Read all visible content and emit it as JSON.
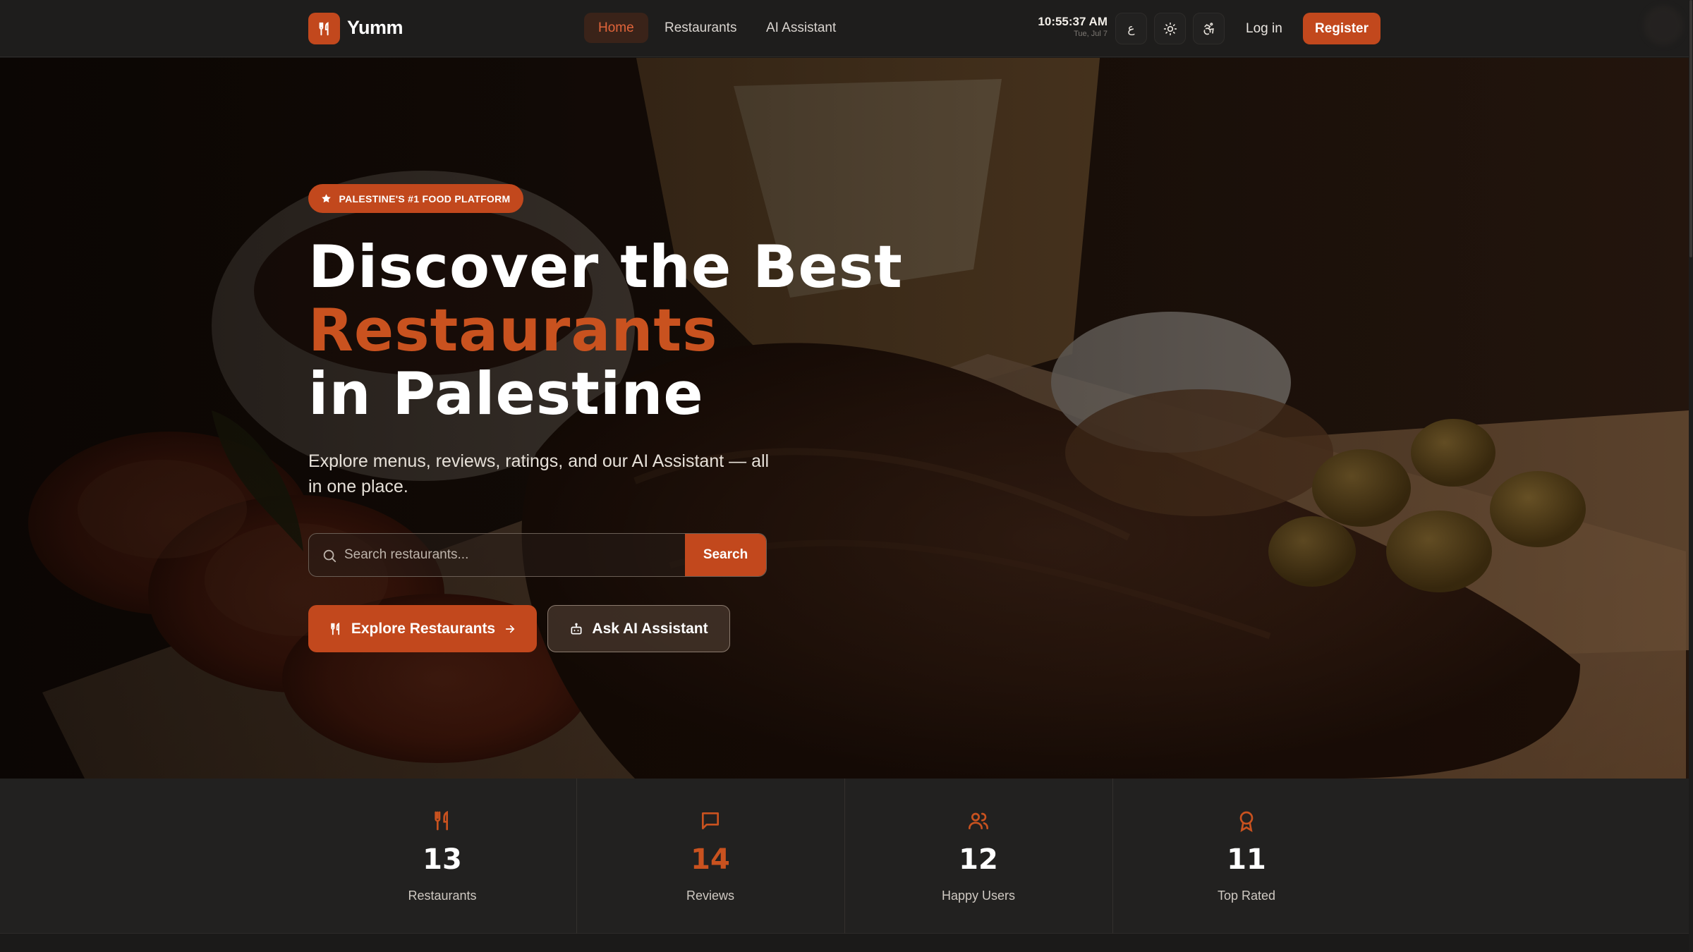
{
  "brand": {
    "name": "Yumm",
    "accent": "#c2481d"
  },
  "nav": {
    "links": [
      "Home",
      "Restaurants",
      "AI Assistant"
    ],
    "active": "Home",
    "clock_time": "10:55:37 AM",
    "clock_date": "Tue, Jul 7",
    "lang_label": "ع",
    "login": "Log in",
    "register": "Register"
  },
  "hero": {
    "badge": "PALESTINE'S #1 FOOD PLATFORM",
    "title_line1": "Discover the Best",
    "title_line2": "Restaurants",
    "title_line3": "in Palestine",
    "subtitle": "Explore menus, reviews, ratings, and our AI Assistant — all in one place.",
    "search_placeholder": "Search restaurants...",
    "search_button": "Search",
    "primary_cta": "Explore Restaurants",
    "secondary_cta": "Ask AI Assistant"
  },
  "stats": [
    {
      "icon": "utensils-icon",
      "value": "13",
      "label": "Restaurants",
      "highlight": false
    },
    {
      "icon": "message-square-icon",
      "value": "14",
      "label": "Reviews",
      "highlight": true
    },
    {
      "icon": "users-icon",
      "value": "12",
      "label": "Happy Users",
      "highlight": false
    },
    {
      "icon": "award-icon",
      "value": "11",
      "label": "Top Rated",
      "highlight": false
    }
  ]
}
